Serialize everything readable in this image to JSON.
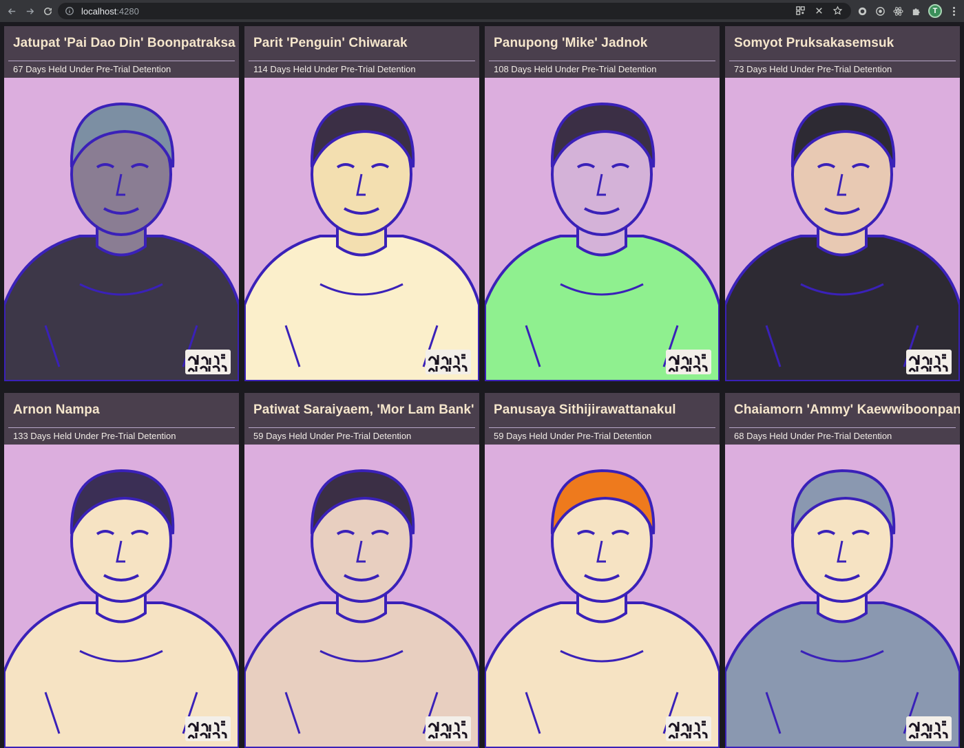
{
  "browser": {
    "url_host": "localhost",
    "url_port": ":4280",
    "profile_initial": "T"
  },
  "colors": {
    "card_header": "#4a3f4d",
    "portrait_bg": "#dcaede",
    "line_ink": "#3a21b8",
    "name_text": "#f5e6cc"
  },
  "cards": [
    {
      "name": "Jatupat 'Pai Dao Din' Boonpatraksa",
      "detention": "67 Days Held Under Pre-Trial Detention",
      "shirt": "#3d3748",
      "skin": "#8a7d93",
      "hair": "#7c8fa3"
    },
    {
      "name": "Parit 'Penguin' Chiwarak",
      "detention": "114 Days Held Under Pre-Trial Detention",
      "shirt": "#fbefcb",
      "skin": "#f3dfb0",
      "hair": "#3b2f45"
    },
    {
      "name": "Panupong 'Mike' Jadnok",
      "detention": "108 Days Held Under Pre-Trial Detention",
      "shirt": "#8ff08f",
      "skin": "#d4b2d8",
      "hair": "#3b2f45"
    },
    {
      "name": "Somyot Pruksakasemsuk",
      "detention": "73 Days Held Under Pre-Trial Detention",
      "shirt": "#2d2a33",
      "skin": "#e8c9b3",
      "hair": "#2d2a33"
    },
    {
      "name": "Arnon Nampa",
      "detention": "133 Days Held Under Pre-Trial Detention",
      "shirt": "#f6e3c3",
      "skin": "#f6e3c3",
      "hair": "#3b2f55"
    },
    {
      "name": "Patiwat Saraiyaem, 'Mor Lam Bank'",
      "detention": "59 Days Held Under Pre-Trial Detention",
      "shirt": "#e8cfc0",
      "skin": "#e8cfc0",
      "hair": "#3b2f45"
    },
    {
      "name": "Panusaya Sithijirawattanakul",
      "detention": "59 Days Held Under Pre-Trial Detention",
      "shirt": "#f6e3c3",
      "skin": "#f6e3c3",
      "hair": "#ee7a1d"
    },
    {
      "name": "Chaiamorn 'Ammy' Kaewwiboonpan",
      "detention": "68 Days Held Under Pre-Trial Detention",
      "shirt": "#8a98b0",
      "skin": "#f6e3c3",
      "hair": "#8a98b0"
    }
  ]
}
